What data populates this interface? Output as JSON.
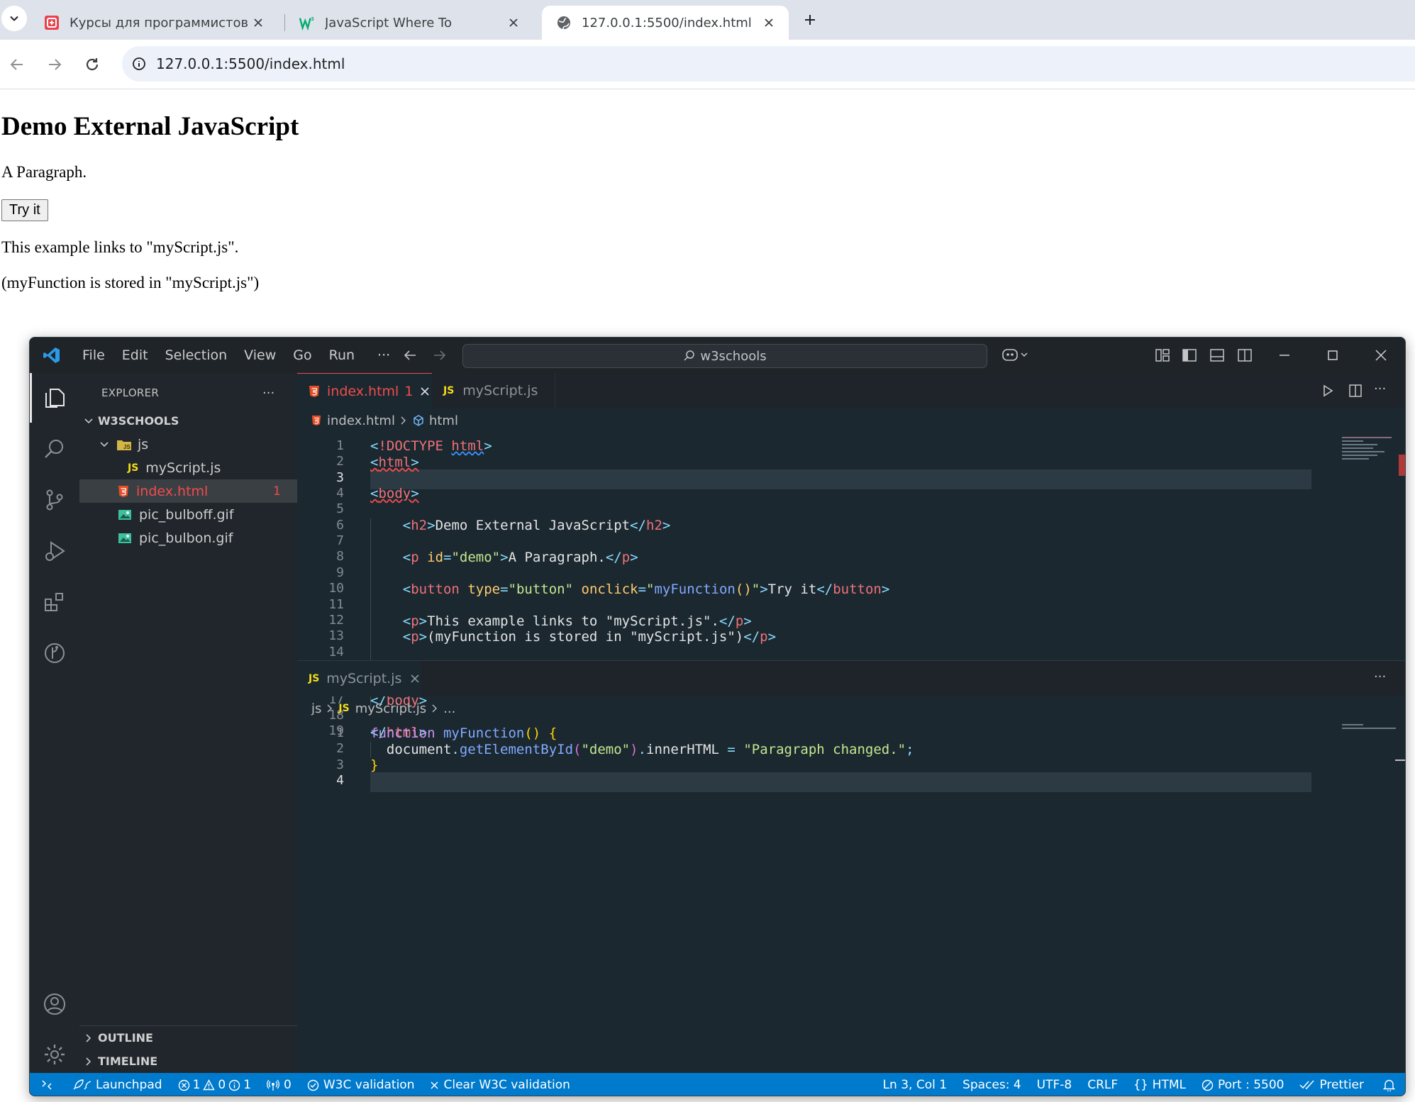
{
  "browser": {
    "tabs": [
      {
        "title": "Курсы для программистов | Bi",
        "icon": "skillbox-favicon"
      },
      {
        "title": "JavaScript Where To",
        "icon": "w3schools-favicon"
      },
      {
        "title": "127.0.0.1:5500/index.html",
        "icon": "globe-favicon"
      }
    ],
    "address": "127.0.0.1:5500/index.html"
  },
  "page": {
    "heading": "Demo External JavaScript",
    "paragraph": "A Paragraph.",
    "button_label": "Try it",
    "line1": "This example links to \"myScript.js\".",
    "line2": "(myFunction is stored in \"myScript.js\")"
  },
  "vscode": {
    "menu": [
      "File",
      "Edit",
      "Selection",
      "View",
      "Go",
      "Run",
      "···"
    ],
    "search": "w3schools",
    "sidebar": {
      "title": "EXPLORER",
      "folder": "W3SCHOOLS",
      "items": [
        {
          "label": "js",
          "type": "folder"
        },
        {
          "label": "myScript.js",
          "type": "js"
        },
        {
          "label": "index.html",
          "type": "html",
          "badge": "1"
        },
        {
          "label": "pic_bulboff.gif",
          "type": "image"
        },
        {
          "label": "pic_bulbon.gif",
          "type": "image"
        }
      ],
      "outline": "OUTLINE",
      "timeline": "TIMELINE"
    },
    "editor1": {
      "tabs": [
        {
          "label": "index.html",
          "badge": "1",
          "js_prefix": ""
        },
        {
          "label": "myScript.js",
          "badge": "",
          "js_prefix": "JS"
        }
      ],
      "breadcrumb": [
        "index.html",
        "html"
      ],
      "line_numbers": [
        "1",
        "2",
        "3",
        "4",
        "5",
        "6",
        "7",
        "8",
        "9",
        "10",
        "11",
        "12",
        "13",
        "14",
        "15",
        "16",
        "17",
        "18",
        "19"
      ]
    },
    "editor2": {
      "tab": {
        "prefix": "JS",
        "label": "myScript.js"
      },
      "breadcrumb": [
        "js",
        "myScript.js",
        "..."
      ],
      "line_numbers": [
        "1",
        "2",
        "3",
        "4"
      ]
    },
    "status": {
      "launchpad": "Launchpad",
      "errors": "1",
      "warnings": "0",
      "infos": "1",
      "ports": "0",
      "w3c": "W3C validation",
      "clear_w3c": "Clear W3C validation",
      "position": "Ln 3, Col 1",
      "spaces": "Spaces: 4",
      "encoding": "UTF-8",
      "eol": "CRLF",
      "language": "HTML",
      "port": "Port : 5500",
      "prettier": "Prettier"
    },
    "colors": {
      "statusbar": "#007acc",
      "editor_bg": "#1b2830",
      "accent_tab": "#f14c4c"
    }
  }
}
